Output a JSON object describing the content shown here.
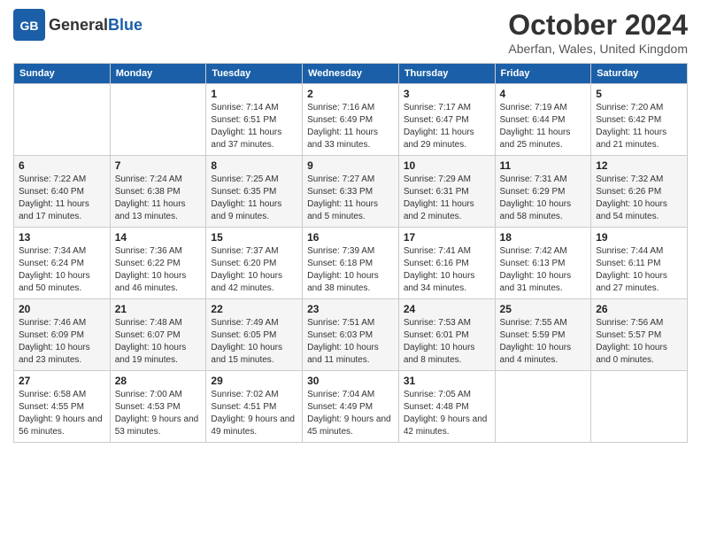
{
  "header": {
    "logo_general": "General",
    "logo_blue": "Blue",
    "month_title": "October 2024",
    "subtitle": "Aberfan, Wales, United Kingdom"
  },
  "weekdays": [
    "Sunday",
    "Monday",
    "Tuesday",
    "Wednesday",
    "Thursday",
    "Friday",
    "Saturday"
  ],
  "weeks": [
    [
      {
        "day": "",
        "info": ""
      },
      {
        "day": "",
        "info": ""
      },
      {
        "day": "1",
        "info": "Sunrise: 7:14 AM\nSunset: 6:51 PM\nDaylight: 11 hours and 37 minutes."
      },
      {
        "day": "2",
        "info": "Sunrise: 7:16 AM\nSunset: 6:49 PM\nDaylight: 11 hours and 33 minutes."
      },
      {
        "day": "3",
        "info": "Sunrise: 7:17 AM\nSunset: 6:47 PM\nDaylight: 11 hours and 29 minutes."
      },
      {
        "day": "4",
        "info": "Sunrise: 7:19 AM\nSunset: 6:44 PM\nDaylight: 11 hours and 25 minutes."
      },
      {
        "day": "5",
        "info": "Sunrise: 7:20 AM\nSunset: 6:42 PM\nDaylight: 11 hours and 21 minutes."
      }
    ],
    [
      {
        "day": "6",
        "info": "Sunrise: 7:22 AM\nSunset: 6:40 PM\nDaylight: 11 hours and 17 minutes."
      },
      {
        "day": "7",
        "info": "Sunrise: 7:24 AM\nSunset: 6:38 PM\nDaylight: 11 hours and 13 minutes."
      },
      {
        "day": "8",
        "info": "Sunrise: 7:25 AM\nSunset: 6:35 PM\nDaylight: 11 hours and 9 minutes."
      },
      {
        "day": "9",
        "info": "Sunrise: 7:27 AM\nSunset: 6:33 PM\nDaylight: 11 hours and 5 minutes."
      },
      {
        "day": "10",
        "info": "Sunrise: 7:29 AM\nSunset: 6:31 PM\nDaylight: 11 hours and 2 minutes."
      },
      {
        "day": "11",
        "info": "Sunrise: 7:31 AM\nSunset: 6:29 PM\nDaylight: 10 hours and 58 minutes."
      },
      {
        "day": "12",
        "info": "Sunrise: 7:32 AM\nSunset: 6:26 PM\nDaylight: 10 hours and 54 minutes."
      }
    ],
    [
      {
        "day": "13",
        "info": "Sunrise: 7:34 AM\nSunset: 6:24 PM\nDaylight: 10 hours and 50 minutes."
      },
      {
        "day": "14",
        "info": "Sunrise: 7:36 AM\nSunset: 6:22 PM\nDaylight: 10 hours and 46 minutes."
      },
      {
        "day": "15",
        "info": "Sunrise: 7:37 AM\nSunset: 6:20 PM\nDaylight: 10 hours and 42 minutes."
      },
      {
        "day": "16",
        "info": "Sunrise: 7:39 AM\nSunset: 6:18 PM\nDaylight: 10 hours and 38 minutes."
      },
      {
        "day": "17",
        "info": "Sunrise: 7:41 AM\nSunset: 6:16 PM\nDaylight: 10 hours and 34 minutes."
      },
      {
        "day": "18",
        "info": "Sunrise: 7:42 AM\nSunset: 6:13 PM\nDaylight: 10 hours and 31 minutes."
      },
      {
        "day": "19",
        "info": "Sunrise: 7:44 AM\nSunset: 6:11 PM\nDaylight: 10 hours and 27 minutes."
      }
    ],
    [
      {
        "day": "20",
        "info": "Sunrise: 7:46 AM\nSunset: 6:09 PM\nDaylight: 10 hours and 23 minutes."
      },
      {
        "day": "21",
        "info": "Sunrise: 7:48 AM\nSunset: 6:07 PM\nDaylight: 10 hours and 19 minutes."
      },
      {
        "day": "22",
        "info": "Sunrise: 7:49 AM\nSunset: 6:05 PM\nDaylight: 10 hours and 15 minutes."
      },
      {
        "day": "23",
        "info": "Sunrise: 7:51 AM\nSunset: 6:03 PM\nDaylight: 10 hours and 11 minutes."
      },
      {
        "day": "24",
        "info": "Sunrise: 7:53 AM\nSunset: 6:01 PM\nDaylight: 10 hours and 8 minutes."
      },
      {
        "day": "25",
        "info": "Sunrise: 7:55 AM\nSunset: 5:59 PM\nDaylight: 10 hours and 4 minutes."
      },
      {
        "day": "26",
        "info": "Sunrise: 7:56 AM\nSunset: 5:57 PM\nDaylight: 10 hours and 0 minutes."
      }
    ],
    [
      {
        "day": "27",
        "info": "Sunrise: 6:58 AM\nSunset: 4:55 PM\nDaylight: 9 hours and 56 minutes."
      },
      {
        "day": "28",
        "info": "Sunrise: 7:00 AM\nSunset: 4:53 PM\nDaylight: 9 hours and 53 minutes."
      },
      {
        "day": "29",
        "info": "Sunrise: 7:02 AM\nSunset: 4:51 PM\nDaylight: 9 hours and 49 minutes."
      },
      {
        "day": "30",
        "info": "Sunrise: 7:04 AM\nSunset: 4:49 PM\nDaylight: 9 hours and 45 minutes."
      },
      {
        "day": "31",
        "info": "Sunrise: 7:05 AM\nSunset: 4:48 PM\nDaylight: 9 hours and 42 minutes."
      },
      {
        "day": "",
        "info": ""
      },
      {
        "day": "",
        "info": ""
      }
    ]
  ]
}
